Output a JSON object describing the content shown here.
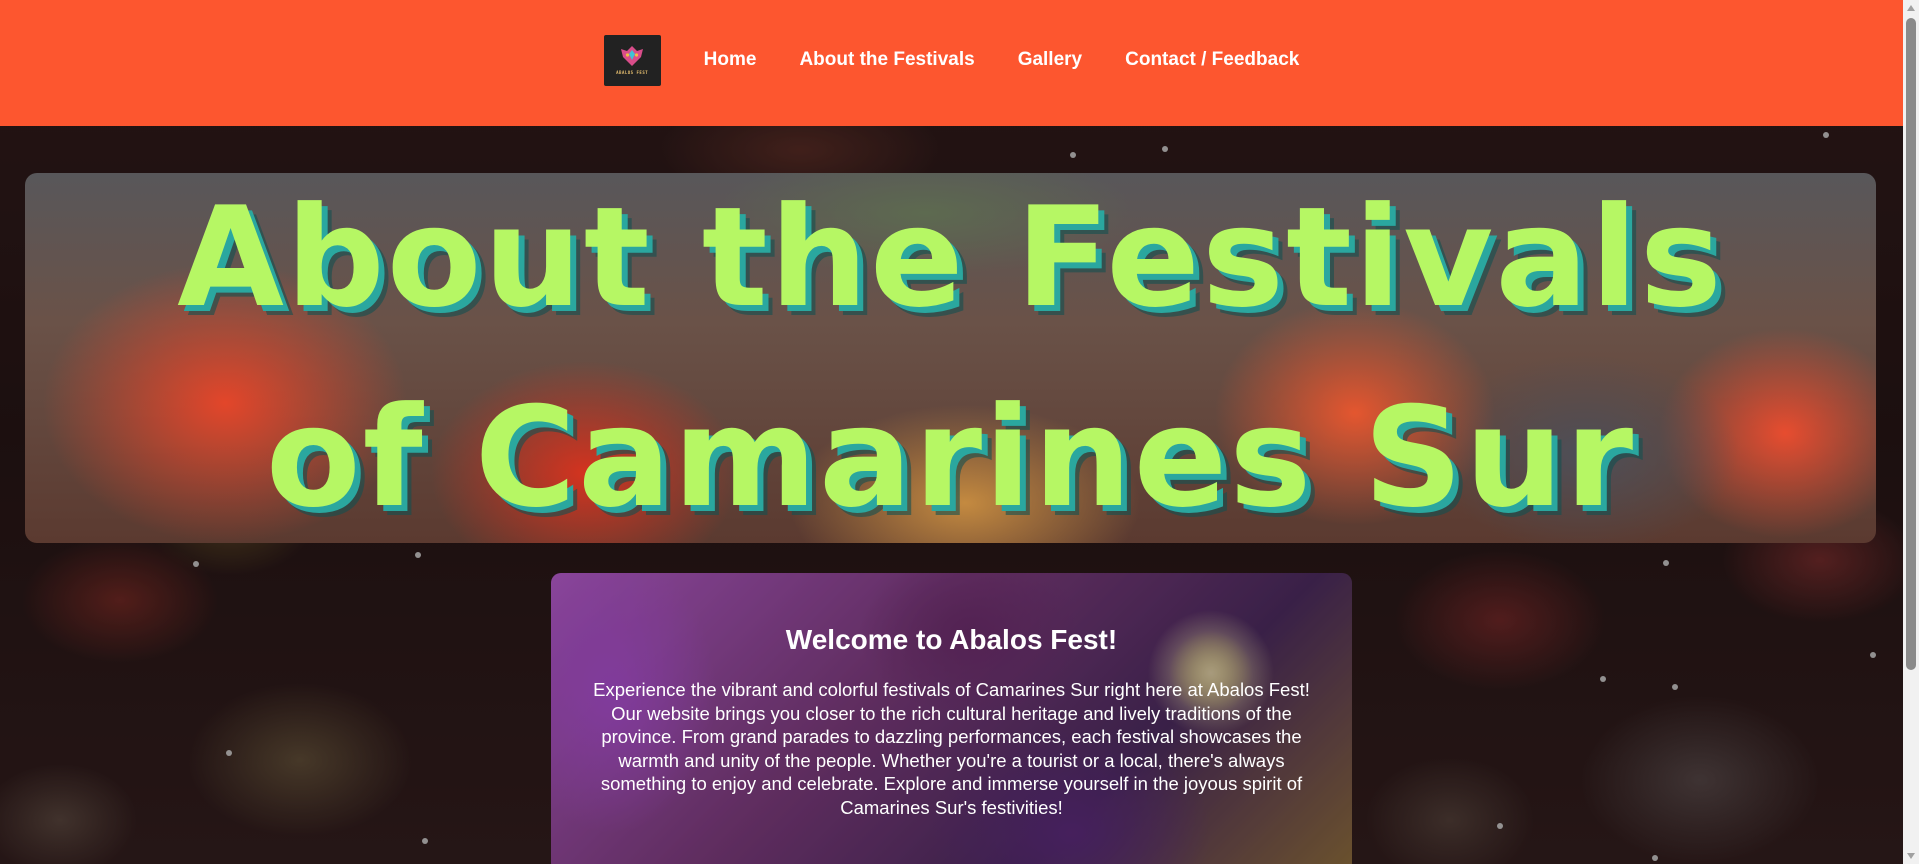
{
  "nav": {
    "logo_text": "ABALOS FEST",
    "items": [
      {
        "label": "Home"
      },
      {
        "label": "About the Festivals"
      },
      {
        "label": "Gallery"
      },
      {
        "label": "Contact / Feedback"
      }
    ]
  },
  "hero": {
    "title_line1": "About the Festivals",
    "title_line2": "of Camarines Sur"
  },
  "welcome": {
    "heading": "Welcome to Abalos Fest!",
    "body": "Experience the vibrant and colorful festivals of Camarines Sur right here at Abalos Fest! Our website brings you closer to the rich cultural heritage and lively traditions of the province. From grand parades to dazzling performances, each festival showcases the warmth and unity of the people. Whether you're a tourist or a local, there's always something to enjoy and celebrate. Explore and immerse yourself in the joyous spirit of Camarines Sur's festivities!"
  },
  "colors": {
    "header": "#fd562f",
    "hero_title": "#b6f764",
    "hero_title_shadow": "#2aa79f"
  }
}
